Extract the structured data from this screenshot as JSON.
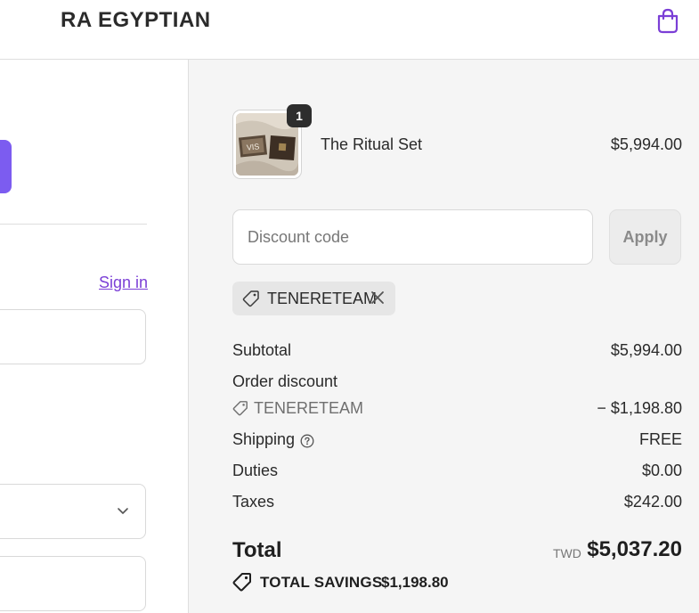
{
  "header": {
    "brand": "RA EGYPTIAN",
    "cart_icon": "shopping-bag-icon"
  },
  "left": {
    "sign_in": "Sign in"
  },
  "order": {
    "item": {
      "name": "The Ritual Set",
      "price": "$5,994.00",
      "quantity": "1",
      "image_text": "VIS"
    },
    "discount": {
      "placeholder": "Discount code",
      "apply_label": "Apply"
    },
    "applied_code": "TENERETEAM",
    "summary": {
      "subtotal_label": "Subtotal",
      "subtotal_value": "$5,994.00",
      "discount_label": "Order discount",
      "discount_code": "TENERETEAM",
      "discount_value": "− $1,198.80",
      "shipping_label": "Shipping",
      "shipping_value": "FREE",
      "duties_label": "Duties",
      "duties_value": "$0.00",
      "taxes_label": "Taxes",
      "taxes_value": "$242.00"
    },
    "total": {
      "label": "Total",
      "currency": "TWD",
      "value": "$5,037.20"
    },
    "savings": {
      "label": "TOTAL SAVINGS",
      "value": "$1,198.80"
    }
  },
  "colors": {
    "accent": "#7c5cf0",
    "link": "#7b3fd6",
    "summary_bg": "#f5f5f5"
  }
}
